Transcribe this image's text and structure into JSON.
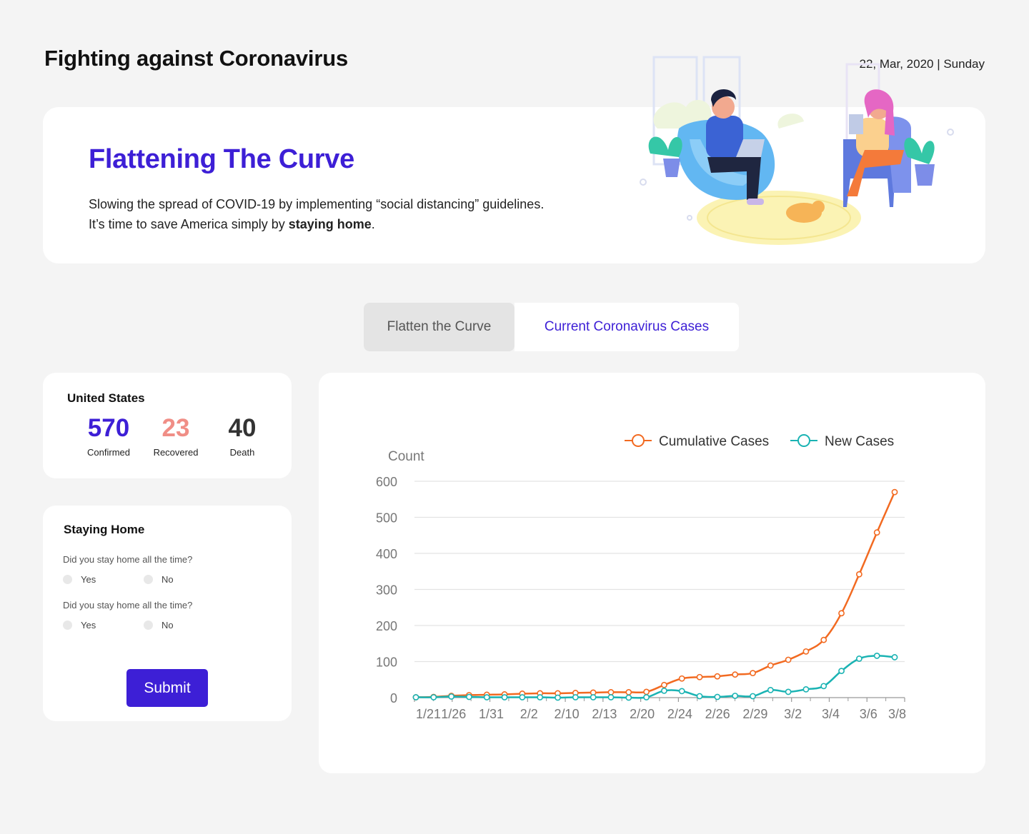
{
  "header": {
    "title": "Fighting against Coronavirus",
    "date": "22, Mar, 2020 | Sunday"
  },
  "hero": {
    "title": "Flattening The Curve",
    "line1": "Slowing the spread of COVID-19 by implementing “social distancing” guidelines.",
    "line2_prefix": "It’s time to save America simply by ",
    "line2_bold": "staying home",
    "line2_suffix": "."
  },
  "tabs": [
    {
      "label": "Flatten the Curve",
      "active": false
    },
    {
      "label": "Current Coronavirus Cases",
      "active": true
    }
  ],
  "stats": {
    "country": "United States",
    "confirmed": {
      "value": "570",
      "label": "Confirmed",
      "color": "#3d1fd6"
    },
    "recovered": {
      "value": "23",
      "label": "Recovered",
      "color": "#f08e86"
    },
    "death": {
      "value": "40",
      "label": "Death",
      "color": "#333333"
    }
  },
  "survey": {
    "title": "Staying Home",
    "questions": [
      {
        "text": "Did you stay home all the time?",
        "options": [
          "Yes",
          "No"
        ]
      },
      {
        "text": "Did you stay home all the time?",
        "options": [
          "Yes",
          "No"
        ]
      }
    ],
    "submit_label": "Submit"
  },
  "colors": {
    "accent": "#3d1fd6",
    "cumulative": "#f26a21",
    "new": "#1ab3b3"
  },
  "chart_data": {
    "type": "line",
    "ylabel": "Count",
    "ylim": [
      0,
      600
    ],
    "yticks": [
      0,
      100,
      200,
      300,
      400,
      500,
      600
    ],
    "xtick_labels": [
      "1/21",
      "1/26",
      "1/31",
      "2/2",
      "2/10",
      "2/13",
      "2/20",
      "2/24",
      "2/26",
      "2/29",
      "3/2",
      "3/4",
      "3/6",
      "3/8"
    ],
    "legend_position": "top-right",
    "grid": true,
    "series": [
      {
        "name": "Cumulative Cases",
        "color": "#f26a21",
        "values": [
          1,
          2,
          5,
          7,
          8,
          9,
          11,
          12,
          12,
          13,
          14,
          15,
          15,
          16,
          35,
          53,
          57,
          59,
          64,
          68,
          89,
          105,
          128,
          160,
          234,
          342,
          458,
          570
        ]
      },
      {
        "name": "New Cases",
        "color": "#1ab3b3",
        "values": [
          1,
          1,
          3,
          2,
          1,
          1,
          1,
          1,
          0,
          1,
          1,
          1,
          0,
          1,
          19,
          18,
          4,
          2,
          5,
          4,
          21,
          16,
          23,
          32,
          74,
          108,
          116,
          112
        ]
      }
    ]
  }
}
